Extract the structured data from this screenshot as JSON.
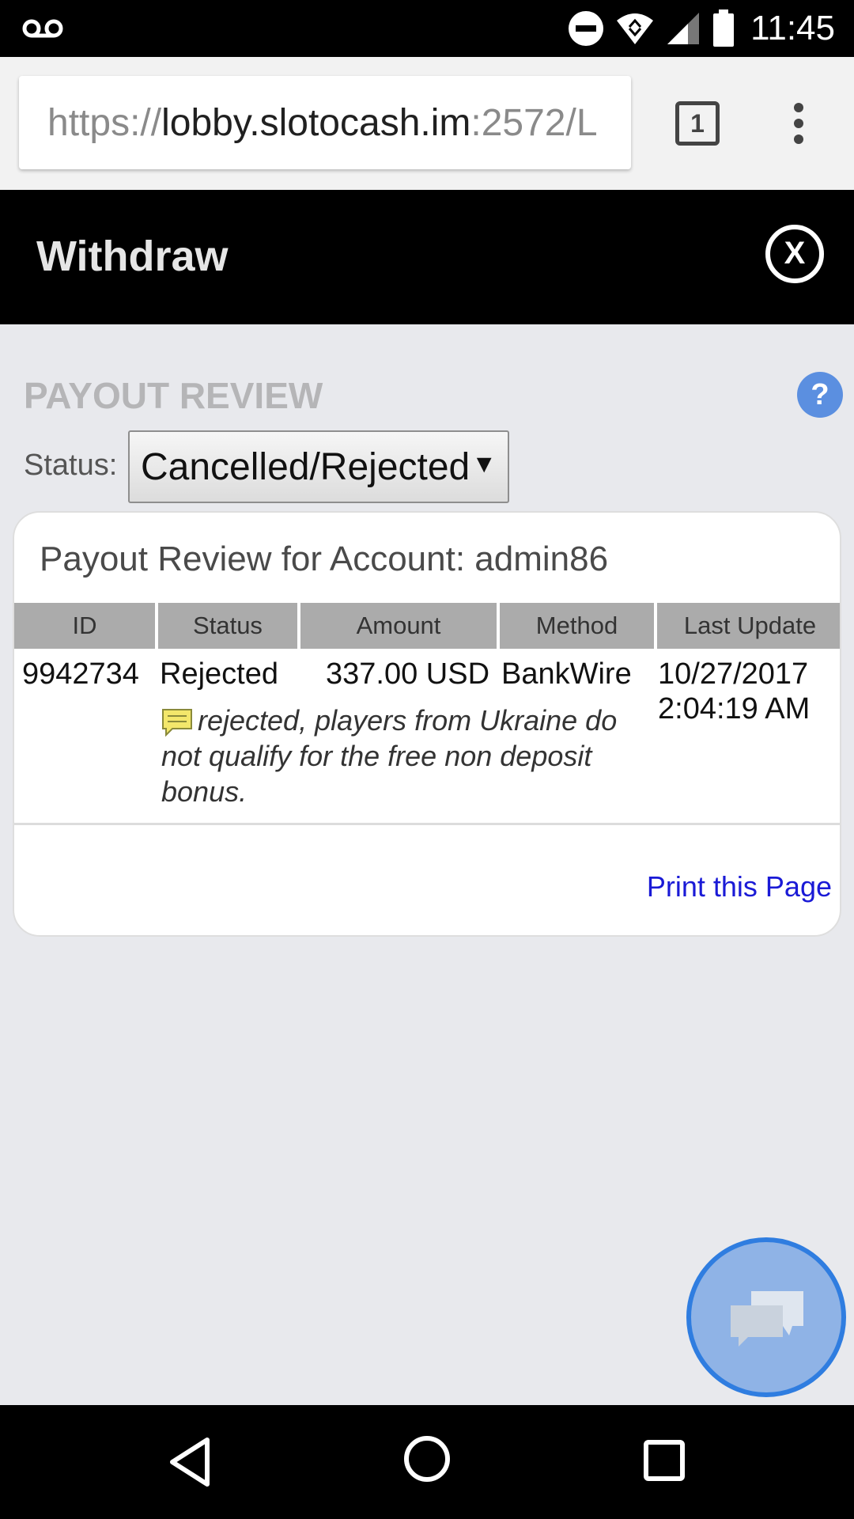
{
  "status_bar": {
    "time": "11:45",
    "icons": [
      "voicemail-icon",
      "do-not-disturb-icon",
      "wifi-icon",
      "signal-icon",
      "battery-icon"
    ]
  },
  "browser": {
    "url_scheme": "https://",
    "url_host": "lobby.slotocash.im",
    "url_rest": ":2572/L",
    "tab_count": "1"
  },
  "header": {
    "title": "Withdraw",
    "close_label": "X"
  },
  "payout": {
    "section_title": "PAYOUT REVIEW",
    "help_label": "?",
    "status_label": "Status:",
    "status_value": "Cancelled/Rejected",
    "card_title": "Payout Review for Account: admin86",
    "columns": [
      "ID",
      "Status",
      "Amount",
      "Method",
      "Last Update"
    ],
    "row": {
      "id": "9942734",
      "status": "Rejected",
      "amount": "337.00 USD",
      "method": "BankWire",
      "last_update_date": "10/27/2017",
      "last_update_time": "2:04:19 AM",
      "note": "rejected, players from Ukraine do not qualify for the free non deposit bonus."
    },
    "print_link": "Print this Page"
  },
  "colors": {
    "header_bg": "#000000",
    "page_bg": "#e8e9ed",
    "help_blue": "#5b8fe0",
    "link_blue": "#1a1ad6",
    "chat_ring": "#2f7de0"
  }
}
